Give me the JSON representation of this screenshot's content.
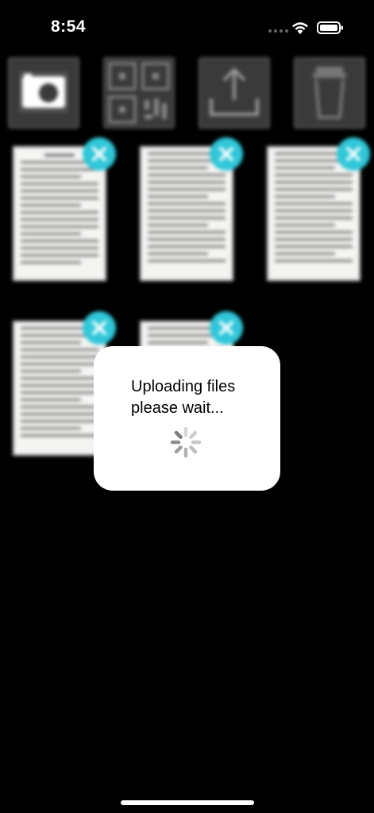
{
  "status_bar": {
    "time": "8:54"
  },
  "toolbar": {
    "buttons": [
      {
        "icon": "camera-icon"
      },
      {
        "icon": "qr-code-icon"
      },
      {
        "icon": "upload-icon"
      },
      {
        "icon": "trash-icon"
      }
    ]
  },
  "documents": {
    "count": 5,
    "remove_icon": "close-icon"
  },
  "loading_dialog": {
    "message": "Uploading files\nplease wait...",
    "icon": "activity-spinner-icon"
  },
  "colors": {
    "background": "#000000",
    "accent": "#2fc7d9",
    "dialog": "#ffffff"
  }
}
